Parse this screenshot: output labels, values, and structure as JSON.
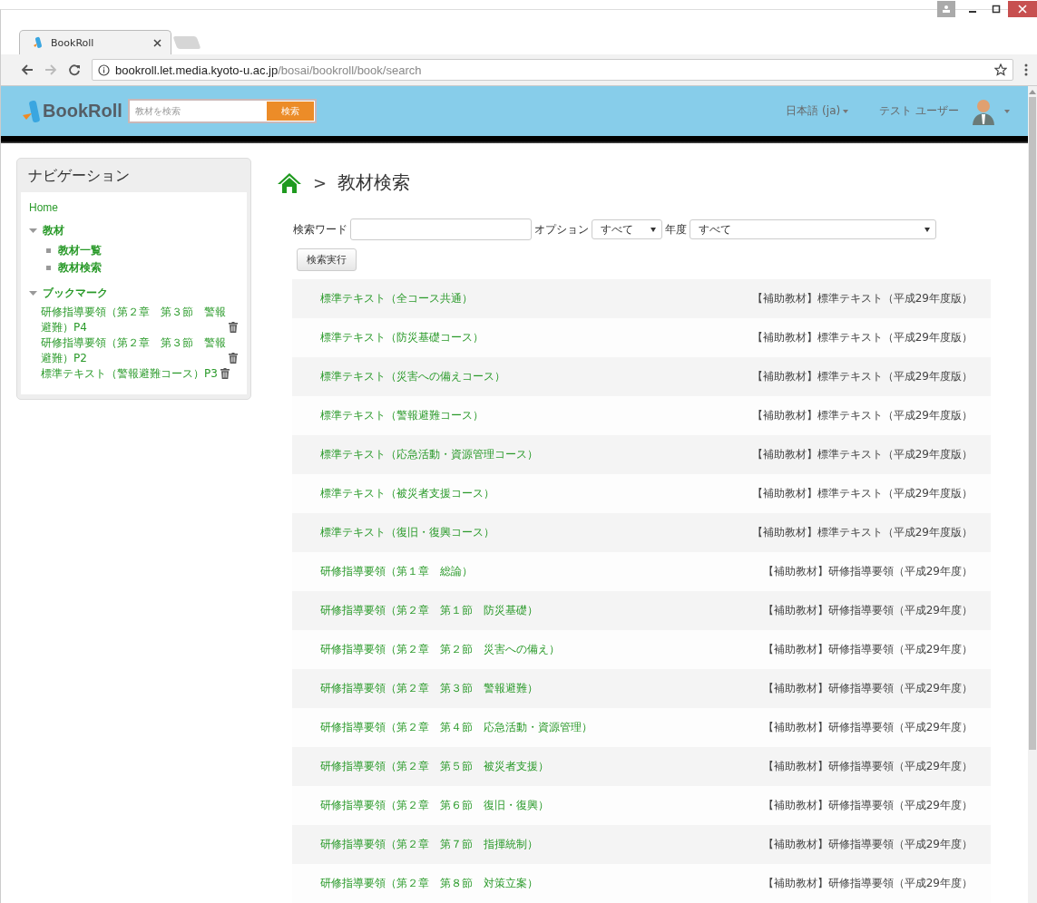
{
  "browser": {
    "tabs": [
      {
        "title": "BookRoll",
        "selected": true
      }
    ],
    "url_host": "bookroll.let.media.kyoto-u.ac.jp",
    "url_path": "/bosai/bookroll/book/search"
  },
  "header": {
    "logo": "BookRoll",
    "search": {
      "placeholder": "教材を検索",
      "button": "検索"
    },
    "language": "日本語 (ja)",
    "user": "テスト ユーザー"
  },
  "navigation": {
    "title": "ナビゲーション",
    "items": [
      {
        "kind": "link",
        "label": "Home"
      },
      {
        "kind": "group",
        "label": "教材",
        "expanded": true,
        "children": [
          {
            "kind": "leaf",
            "label": "教材一覧"
          },
          {
            "kind": "leaf",
            "label": "教材検索"
          }
        ]
      },
      {
        "kind": "group",
        "label": "ブックマーク",
        "expanded": true,
        "children": [
          {
            "kind": "bookmark",
            "label": "研修指導要領（第２章　第３節　警報避難）P4"
          },
          {
            "kind": "bookmark",
            "label": "研修指導要領（第２章　第３節　警報避難）P2"
          },
          {
            "kind": "bookmark",
            "label": "標準テキスト（警報避難コース）P3"
          }
        ]
      }
    ]
  },
  "page": {
    "breadcrumb_separator": ">",
    "title": "教材検索"
  },
  "search_form": {
    "word_label": "検索ワード",
    "option_label": "オプション",
    "option_value": "すべて",
    "year_label": "年度",
    "year_value": "すべて",
    "submit": "検索実行"
  },
  "results": [
    {
      "title": "標準テキスト（全コース共通）",
      "category": "【補助教材】標準テキスト（平成29年度版）"
    },
    {
      "title": "標準テキスト（防災基礎コース）",
      "category": "【補助教材】標準テキスト（平成29年度版）"
    },
    {
      "title": "標準テキスト（災害への備えコース）",
      "category": "【補助教材】標準テキスト（平成29年度版）"
    },
    {
      "title": "標準テキスト（警報避難コース）",
      "category": "【補助教材】標準テキスト（平成29年度版）"
    },
    {
      "title": "標準テキスト（応急活動・資源管理コース）",
      "category": "【補助教材】標準テキスト（平成29年度版）"
    },
    {
      "title": "標準テキスト（被災者支援コース）",
      "category": "【補助教材】標準テキスト（平成29年度版）"
    },
    {
      "title": "標準テキスト（復旧・復興コース）",
      "category": "【補助教材】標準テキスト（平成29年度版）"
    },
    {
      "title": "研修指導要領（第１章　総論）",
      "category": "【補助教材】研修指導要領（平成29年度）"
    },
    {
      "title": "研修指導要領（第２章　第１節　防災基礎）",
      "category": "【補助教材】研修指導要領（平成29年度）"
    },
    {
      "title": "研修指導要領（第２章　第２節　災害への備え）",
      "category": "【補助教材】研修指導要領（平成29年度）"
    },
    {
      "title": "研修指導要領（第２章　第３節　警報避難）",
      "category": "【補助教材】研修指導要領（平成29年度）"
    },
    {
      "title": "研修指導要領（第２章　第４節　応急活動・資源管理）",
      "category": "【補助教材】研修指導要領（平成29年度）"
    },
    {
      "title": "研修指導要領（第２章　第５節　被災者支援）",
      "category": "【補助教材】研修指導要領（平成29年度）"
    },
    {
      "title": "研修指導要領（第２章　第６節　復旧・復興）",
      "category": "【補助教材】研修指導要領（平成29年度）"
    },
    {
      "title": "研修指導要領（第２章　第７節　指揮統制）",
      "category": "【補助教材】研修指導要領（平成29年度）"
    },
    {
      "title": "研修指導要領（第２章　第８節　対策立案）",
      "category": "【補助教材】研修指導要領（平成29年度）"
    }
  ]
}
